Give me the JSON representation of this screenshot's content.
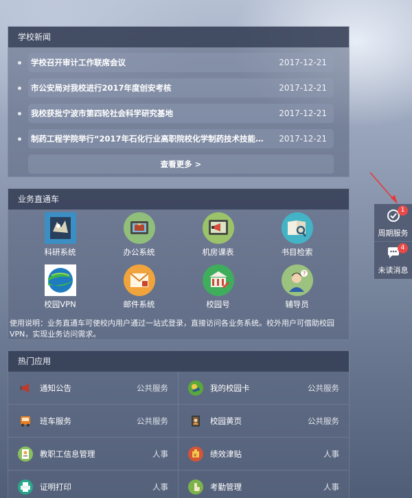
{
  "news": {
    "title": "学校新闻",
    "items": [
      {
        "title": "学校召开审计工作联席会议",
        "date": "2017-12-21"
      },
      {
        "title": "市公安局对我校进行2017年度创安考核",
        "date": "2017-12-21"
      },
      {
        "title": "我校获批宁波市第四轮社会科学研究基地",
        "date": "2017-12-21"
      },
      {
        "title": "制药工程学院举行“2017年石化行业高职院校化学制药技术技能大...",
        "date": "2017-12-21"
      }
    ],
    "more_label": "查看更多 >"
  },
  "services": {
    "title": "业务直通车",
    "items": [
      {
        "label": "科研系统",
        "icon": "research-icon",
        "color": "#3b8fc4"
      },
      {
        "label": "办公系统",
        "icon": "briefcase-icon",
        "color": "#8fbf7a"
      },
      {
        "label": "机房课表",
        "icon": "megaphone-board-icon",
        "color": "#9bc36a"
      },
      {
        "label": "书目检索",
        "icon": "book-search-icon",
        "color": "#43b3c6"
      },
      {
        "label": "校园VPN",
        "icon": "vpn-globe-icon",
        "color": "#2e8a5a"
      },
      {
        "label": "邮件系统",
        "icon": "mail-icon",
        "color": "#f2a43c"
      },
      {
        "label": "校园号",
        "icon": "campus-building-icon",
        "color": "#3fae5c"
      },
      {
        "label": "辅导员",
        "icon": "counselor-icon",
        "color": "#9cc27f"
      }
    ],
    "note": "使用说明：业务直通车可使校内用户通过一站式登录，直接访问各业务系统。校外用户可借助校园VPN，实现业务访问需求。"
  },
  "hot": {
    "title": "热门应用",
    "items": [
      {
        "label": "通知公告",
        "category": "公共服务",
        "icon": "megaphone-icon",
        "color": "#c0392b"
      },
      {
        "label": "我的校园卡",
        "category": "公共服务",
        "icon": "campus-card-icon",
        "color": "#5aa83c"
      },
      {
        "label": "班车服务",
        "category": "公共服务",
        "icon": "bus-icon",
        "color": "#e67e22"
      },
      {
        "label": "校园黄页",
        "category": "公共服务",
        "icon": "yellow-pages-icon",
        "color": "#7a5b3a"
      },
      {
        "label": "教职工信息管理",
        "category": "人事",
        "icon": "staff-info-icon",
        "color": "#8bbf5e"
      },
      {
        "label": "绩效津贴",
        "category": "人事",
        "icon": "performance-icon",
        "color": "#d35436"
      },
      {
        "label": "证明打印",
        "category": "人事",
        "icon": "printer-icon",
        "color": "#2aa88c"
      },
      {
        "label": "考勤管理",
        "category": "人事",
        "icon": "attendance-icon",
        "color": "#7bb44a"
      }
    ]
  },
  "dock": {
    "items": [
      {
        "label": "周期服务",
        "badge": "1",
        "icon": "check-circle-icon"
      },
      {
        "label": "未读消息",
        "badge": "4",
        "icon": "chat-bubble-icon"
      }
    ]
  }
}
